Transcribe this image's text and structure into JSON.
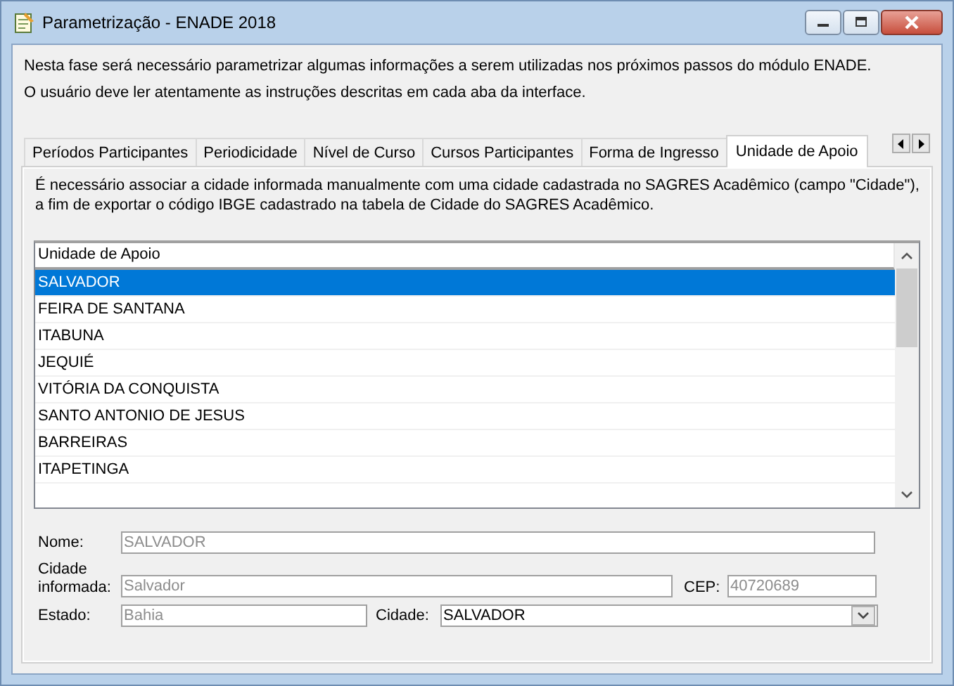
{
  "window": {
    "title": "Parametrização - ENADE 2018"
  },
  "intro": [
    "Nesta fase será necessário parametrizar algumas informações a serem utilizadas nos próximos passos do módulo ENADE.",
    "O usuário deve ler atentamente as instruções descritas em cada aba da interface."
  ],
  "tabs": [
    {
      "label": "Períodos Participantes",
      "selected": false
    },
    {
      "label": "Periodicidade",
      "selected": false
    },
    {
      "label": "Nível de Curso",
      "selected": false
    },
    {
      "label": "Cursos Participantes",
      "selected": false
    },
    {
      "label": "Forma de Ingresso",
      "selected": false
    },
    {
      "label": "Unidade de Apoio",
      "selected": true
    }
  ],
  "panel": {
    "instructions": [
      "É necessário associar a cidade informada manualmente com uma cidade cadastrada no SAGRES Acadêmico (campo \"Cidade\"),",
      "a fim de exportar o código IBGE cadastrado na tabela de Cidade do SAGRES Acadêmico."
    ],
    "list": {
      "column": "Unidade de Apoio",
      "rows": [
        {
          "text": "SALVADOR",
          "selected": true
        },
        {
          "text": "FEIRA DE SANTANA",
          "selected": false
        },
        {
          "text": "ITABUNA",
          "selected": false
        },
        {
          "text": "JEQUIÉ",
          "selected": false
        },
        {
          "text": "VITÓRIA DA CONQUISTA",
          "selected": false
        },
        {
          "text": "SANTO ANTONIO DE JESUS",
          "selected": false
        },
        {
          "text": "BARREIRAS",
          "selected": false
        },
        {
          "text": "ITAPETINGA",
          "selected": false
        }
      ]
    },
    "form": {
      "nome": {
        "label": "Nome:",
        "value": "SALVADOR",
        "disabled": true
      },
      "cidade_informada": {
        "label": [
          "Cidade",
          "informada:"
        ],
        "value": "Salvador",
        "disabled": true
      },
      "cep": {
        "label": "CEP:",
        "value": "40720689",
        "disabled": true
      },
      "estado": {
        "label": "Estado:",
        "value": "Bahia",
        "disabled": true
      },
      "cidade": {
        "label": "Cidade:",
        "value": "SALVADOR",
        "disabled": false
      }
    }
  }
}
